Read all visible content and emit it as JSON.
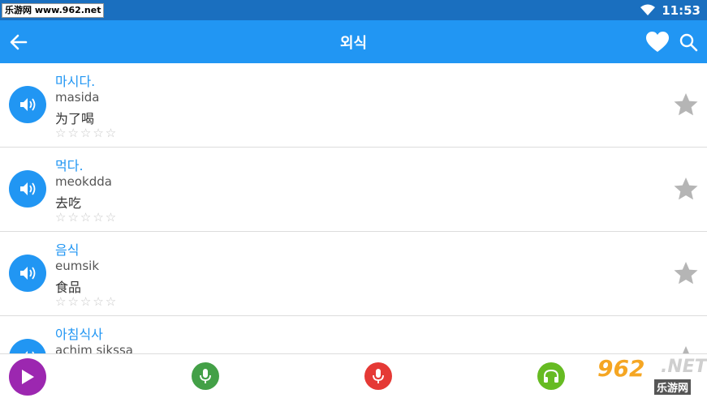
{
  "status_bar": {
    "watermark": "乐游网 www.962.net",
    "time": "11:53"
  },
  "app_bar": {
    "title": "외식"
  },
  "phrases": [
    {
      "korean": "마시다.",
      "romanization": "masida",
      "chinese": "为了喝",
      "stars": "☆☆☆☆☆"
    },
    {
      "korean": "먹다.",
      "romanization": "meokdda",
      "chinese": "去吃",
      "stars": "☆☆☆☆☆"
    },
    {
      "korean": "음식",
      "romanization": "eumsik",
      "chinese": "食品",
      "stars": "☆☆☆☆☆"
    },
    {
      "korean": "아침식사",
      "romanization": "achim sikssa",
      "chinese": "",
      "stars": ""
    }
  ],
  "bottom_watermark": {
    "brand": "962",
    "suffix": ".NET",
    "name": "乐游网"
  },
  "icons": {
    "back": "arrow-left-icon",
    "heart": "heart-icon",
    "search": "search-icon",
    "speaker": "speaker-icon",
    "star": "star-icon",
    "play": "play-icon",
    "mic": "mic-icon",
    "headphones": "headphones-icon"
  },
  "colors": {
    "primary": "#2196f3",
    "status_bar": "#1a6fbf",
    "play": "#9c27b0",
    "mic_green": "#43a047",
    "mic_red": "#e53935",
    "headphones": "#66bb22",
    "star_inactive": "#b5b5b5"
  }
}
